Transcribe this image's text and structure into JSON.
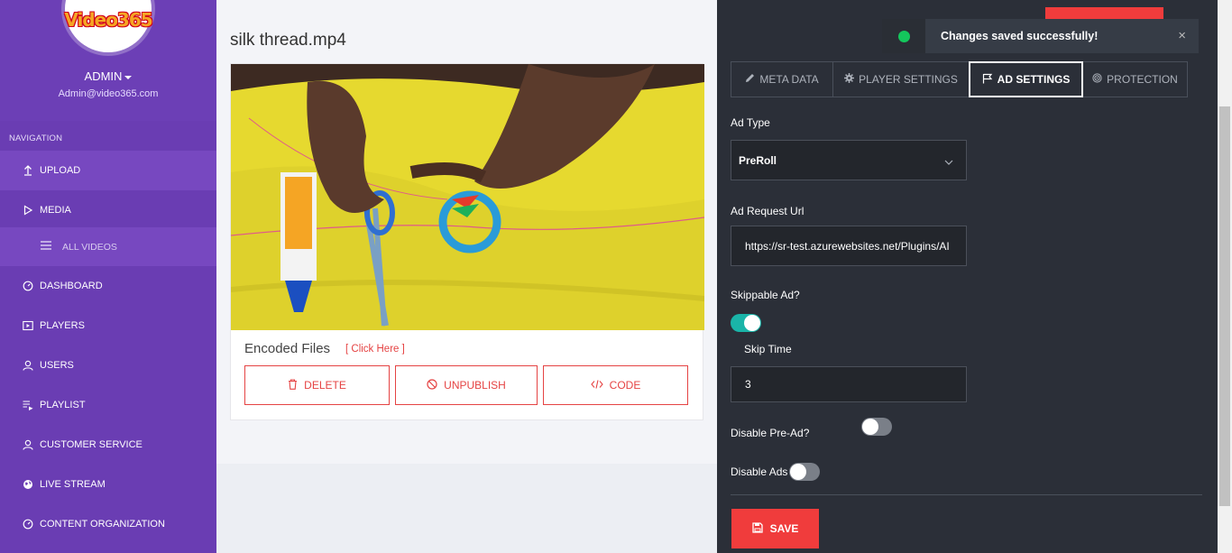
{
  "sidebar": {
    "logo_text": "Video365",
    "admin_name": "ADMIN",
    "admin_email": "Admin@video365.com",
    "nav_heading": "NAVIGATION",
    "items": [
      {
        "label": "UPLOAD",
        "icon": "upload-icon"
      },
      {
        "label": "MEDIA",
        "icon": "play-icon"
      },
      {
        "label": "DASHBOARD",
        "icon": "gauge-icon"
      },
      {
        "label": "PLAYERS",
        "icon": "player-icon"
      },
      {
        "label": "USERS",
        "icon": "user-icon"
      },
      {
        "label": "PLAYLIST",
        "icon": "playlist-icon"
      },
      {
        "label": "CUSTOMER SERVICE",
        "icon": "user-icon"
      },
      {
        "label": "LIVE STREAM",
        "icon": "globe-icon"
      },
      {
        "label": "CONTENT ORGANIZATION",
        "icon": "gauge-icon"
      }
    ],
    "subitem": {
      "label": "ALL VIDEOS",
      "icon": "list-icon"
    }
  },
  "main": {
    "video_title": "silk thread.mp4",
    "encoded_files_label": "Encoded Files",
    "click_here": "[ Click Here ]",
    "buttons": {
      "delete": "DELETE",
      "unpublish": "UNPUBLISH",
      "code": "CODE"
    }
  },
  "toast": {
    "message": "Changes saved successfully!",
    "close": "×"
  },
  "panel": {
    "tabs": [
      {
        "label": "META DATA",
        "icon": "pencil-icon"
      },
      {
        "label": "PLAYER SETTINGS",
        "icon": "gear-icon"
      },
      {
        "label": "AD SETTINGS",
        "icon": "flag-icon"
      },
      {
        "label": "PROTECTION",
        "icon": "target-icon"
      }
    ],
    "active_tab": "AD SETTINGS",
    "ad_type_label": "Ad Type",
    "ad_type_value": "PreRoll",
    "ad_request_url_label": "Ad Request Url",
    "ad_request_url_value": "https://sr-test.azurewebsites.net/Plugins/AI",
    "skippable_label": "Skippable Ad?",
    "skippable_on": true,
    "skip_time_label": "Skip Time",
    "skip_time_value": "3",
    "disable_pre_ad_label": "Disable Pre-Ad?",
    "disable_pre_ad_on": false,
    "disable_ads_label": "Disable Ads",
    "disable_ads_on": false,
    "save_label": "SAVE"
  },
  "colors": {
    "sidebar": "#6c3fb6",
    "panel": "#2b2f38",
    "accent_red": "#f03c3c",
    "toggle_on": "#1ab4a8",
    "toast_dot": "#14c75c"
  }
}
